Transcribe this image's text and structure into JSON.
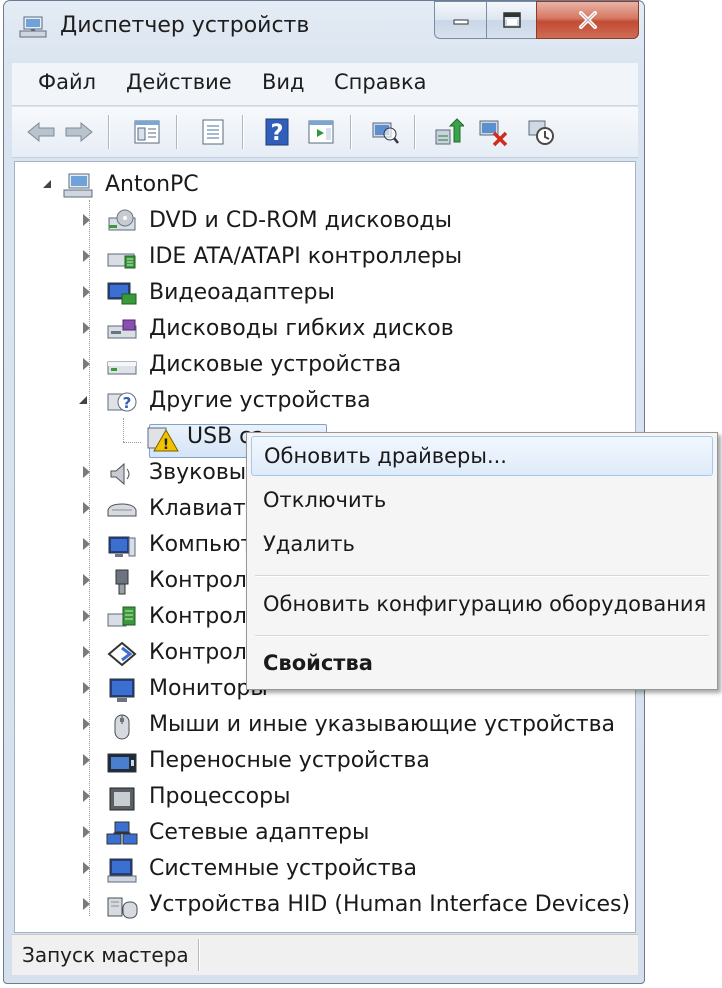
{
  "window": {
    "title": "Диспетчер устройств"
  },
  "menubar": {
    "items": [
      "Файл",
      "Действие",
      "Вид",
      "Справка"
    ]
  },
  "toolbar": {
    "icons": [
      "back-arrow-icon",
      "forward-arrow-icon",
      "show-hide-console-tree-icon",
      "properties-icon",
      "help-icon",
      "action-pane-icon",
      "scan-hardware-icon",
      "update-driver-icon",
      "uninstall-icon",
      "disable-device-icon"
    ]
  },
  "tree": {
    "root": "AntonPC",
    "items": [
      {
        "label": "DVD и CD-ROM дисководы",
        "icon": "dvd-drive-icon"
      },
      {
        "label": "IDE ATA/ATAPI контроллеры",
        "icon": "ide-controller-icon"
      },
      {
        "label": "Видеоадаптеры",
        "icon": "display-adapter-icon"
      },
      {
        "label": "Дисководы гибких дисков",
        "icon": "floppy-drive-icon"
      },
      {
        "label": "Дисковые устройства",
        "icon": "disk-drive-icon"
      },
      {
        "label": "Другие устройства",
        "icon": "unknown-device-icon"
      },
      {
        "label": "USB ca",
        "icon": "warning-device-icon"
      },
      {
        "label": "Звуковые",
        "icon": "speaker-icon"
      },
      {
        "label": "Клавиату",
        "icon": "keyboard-icon"
      },
      {
        "label": "Компьют",
        "icon": "computer-icon"
      },
      {
        "label": "Контролл",
        "icon": "usb-controller-icon"
      },
      {
        "label": "Контролл",
        "icon": "storage-controller-icon"
      },
      {
        "label": "Контролл",
        "icon": "ieee-controller-icon"
      },
      {
        "label": "Мониторы",
        "icon": "monitor-icon"
      },
      {
        "label": "Мыши и иные указывающие устройства",
        "icon": "mouse-icon"
      },
      {
        "label": "Переносные устройства",
        "icon": "portable-device-icon"
      },
      {
        "label": "Процессоры",
        "icon": "processor-icon"
      },
      {
        "label": "Сетевые адаптеры",
        "icon": "network-adapter-icon"
      },
      {
        "label": "Системные устройства",
        "icon": "system-device-icon"
      },
      {
        "label": "Устройства HID (Human Interface Devices)",
        "icon": "hid-device-icon"
      }
    ]
  },
  "context_menu": {
    "update_drivers": "Обновить драйверы...",
    "disable": "Отключить",
    "uninstall": "Удалить",
    "scan_hardware": "Обновить конфигурацию оборудования",
    "properties": "Свойства"
  },
  "statusbar": {
    "text": "Запуск мастера"
  },
  "colors": {
    "accent": "#3c7fb1",
    "close_button": "#c24b33",
    "warning": "#f2c200"
  }
}
